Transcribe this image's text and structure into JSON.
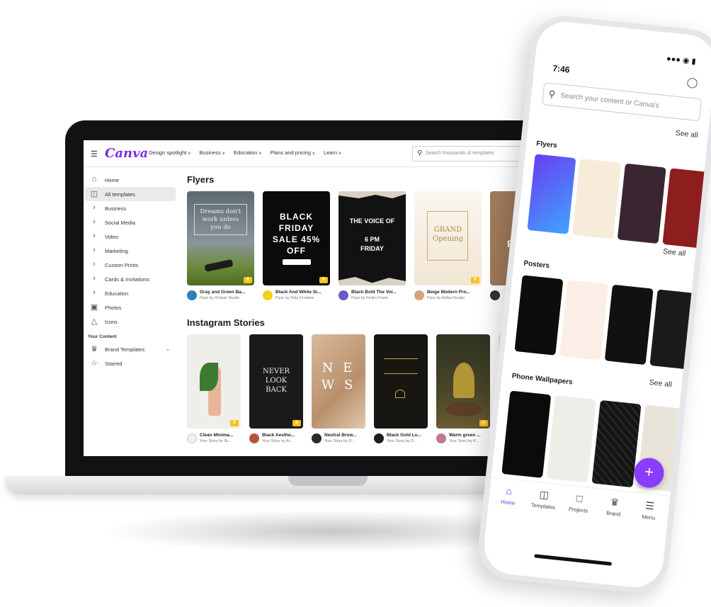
{
  "desktop": {
    "logo": "Canva",
    "nav": [
      "Design spotlight",
      "Business",
      "Education",
      "Plans and pricing",
      "Learn"
    ],
    "search_placeholder": "Search thousands of templates",
    "sidebar": {
      "items": [
        {
          "label": "Home",
          "icon": "home-icon"
        },
        {
          "label": "All templates",
          "icon": "templates-icon",
          "active": true
        },
        {
          "label": "Business",
          "icon": "chevron-right-icon"
        },
        {
          "label": "Social Media",
          "icon": "chevron-right-icon"
        },
        {
          "label": "Video",
          "icon": "chevron-right-icon"
        },
        {
          "label": "Marketing",
          "icon": "chevron-right-icon"
        },
        {
          "label": "Custom Prints",
          "icon": "chevron-right-icon"
        },
        {
          "label": "Cards & Invitations",
          "icon": "chevron-right-icon"
        },
        {
          "label": "Education",
          "icon": "chevron-right-icon"
        },
        {
          "label": "Photos",
          "icon": "photo-icon"
        },
        {
          "label": "Icons",
          "icon": "shapes-icon"
        }
      ],
      "your_content_heading": "Your Content",
      "content_items": [
        {
          "label": "Brand Templates",
          "icon": "brand-icon"
        },
        {
          "label": "Starred",
          "icon": "star-icon"
        }
      ]
    },
    "flyers": {
      "title": "Flyers",
      "cards": [
        {
          "title": "Gray and Green Ba...",
          "by": "Flyer by Ombak Studio",
          "text": "Dreams don't\nwork unless\nyou do"
        },
        {
          "title": "Black And White Si...",
          "by": "Flyer by Dola Creative",
          "text": "BLACK\nFRIDAY\nSALE 45% OFF"
        },
        {
          "title": "Black Bold The Voi...",
          "by": "Flyer by Pedro Frano",
          "text": "THE VOICE OF\n\n6 PM\nFRIDAY"
        },
        {
          "title": "Beige Modern Pro...",
          "by": "Flyer by Adika Design",
          "text": "GRAND\nOpening"
        },
        {
          "title": "",
          "by": "",
          "text": "FA"
        }
      ]
    },
    "stories": {
      "title": "Instagram Stories",
      "cards": [
        {
          "title": "Clean Minima...",
          "by": "Your Story by St...",
          "text": ""
        },
        {
          "title": "Black Aesthe...",
          "by": "Your Story by Ar...",
          "text": "NEVER\nLOOK\nBACK"
        },
        {
          "title": "Neutral Brow...",
          "by": "Your Story by D...",
          "text": "N E\nW S"
        },
        {
          "title": "Black Gold Lu...",
          "by": "Your Story by D...",
          "text": ""
        },
        {
          "title": "Warm green ...",
          "by": "Your Story by K...",
          "text": ""
        }
      ]
    }
  },
  "phone": {
    "time": "7:46",
    "search_placeholder": "Search your content or Canva's",
    "sections": [
      {
        "label": "Flyers",
        "see_all": "See all"
      },
      {
        "label": "Posters",
        "see_all": "See all"
      },
      {
        "label": "Phone Wallpapers",
        "see_all": "See all"
      }
    ],
    "nav": [
      {
        "label": "Home",
        "icon": "home-icon",
        "active": true
      },
      {
        "label": "Templates",
        "icon": "templates-icon"
      },
      {
        "label": "Projects",
        "icon": "folder-icon"
      },
      {
        "label": "Brand",
        "icon": "crown-icon"
      },
      {
        "label": "Menu",
        "icon": "menu-icon"
      }
    ],
    "fab": "+"
  },
  "colors": {
    "brand": "#7d2ae8",
    "fab": "#8b3dff",
    "premium": "#f7c31c"
  }
}
